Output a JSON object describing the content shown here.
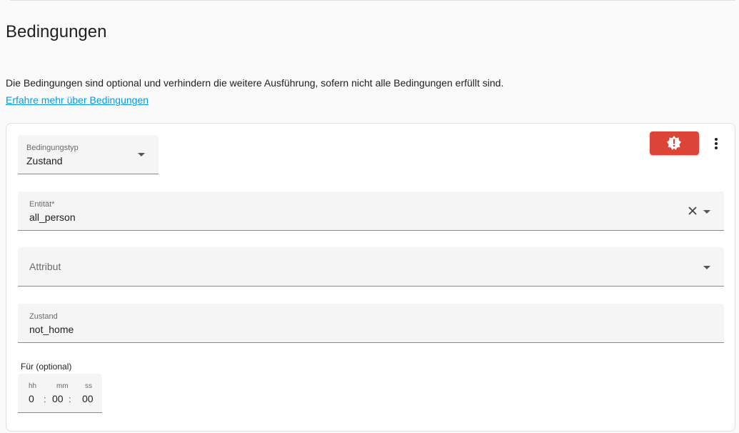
{
  "section": {
    "title": "Bedingungen",
    "description": "Die Bedingungen sind optional und verhindern die weitere Ausführung, sofern nicht alle Bedingungen erfüllt sind.",
    "learn_more": "Erfahre mehr über Bedingungen"
  },
  "condition": {
    "type_label": "Bedingungstyp",
    "type_value": "Zustand",
    "entity_label": "Entität*",
    "entity_value": "all_person",
    "attribute_placeholder": "Attribut",
    "state_label": "Zustand",
    "state_value": "not_home",
    "duration_label": "Für (optional)",
    "duration": {
      "hh_label": "hh",
      "hh": "0",
      "mm_label": "mm",
      "mm": "00",
      "ss_label": "ss",
      "ss": "00",
      "separator": ":"
    },
    "warning_button_icon": "alert-badge-icon",
    "menu_icon": "dots-vertical-icon",
    "warning_color": "#db4437"
  },
  "colors": {
    "link": "#039be5",
    "background": "#fafafa",
    "card": "#ffffff"
  }
}
